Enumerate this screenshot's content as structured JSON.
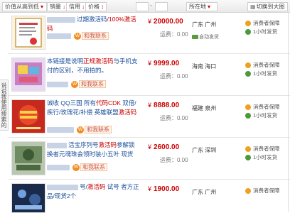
{
  "toolbar": {
    "credit_sort": "价值从高到低",
    "volume": "销量",
    "credit": "信用",
    "price": "价格",
    "price_from_placeholder": "",
    "price_to_placeholder": "",
    "all_regions": "所在地",
    "view_toggle": "切换到大图"
  },
  "sidebar_tab": "说说我使用搜索的感受",
  "listings": [
    {
      "title_pre": "",
      "title_mid": "过期激活码",
      "title_hl": "/100%激活码",
      "title_rest": "",
      "ww_text": "和我联系",
      "price": "20000.00",
      "currency": "¥",
      "sold": "运费：0.00",
      "location": "广东 广州",
      "ship_tag": "自动发货",
      "badge1": "消费者保障",
      "badge2": "1小时发货"
    },
    {
      "title_pre": "本链接是说明",
      "title_hl": "正规激活码",
      "title_mid": "与手机支付的区别，不用拍的。",
      "title_rest": "",
      "ww_text": "和我联系",
      "price": "9999.00",
      "currency": "¥",
      "sold": "运费：0.00",
      "location": "海南 海口",
      "ship_tag": "",
      "badge1": "消费者保障",
      "badge2": "1小时发货"
    },
    {
      "title_pre": "诚收 QQ三国 所有",
      "title_hl": "代码CDK",
      "title_mid": " 双倍/疾行/玫瑰花/补偿 英雄联盟",
      "title_rest": "激活码",
      "ww_text": "和我联系",
      "price": "8888.00",
      "currency": "¥",
      "sold": "运费：0.00",
      "location": "福建 泉州",
      "ship_tag": "",
      "badge1": "消费者保障",
      "badge2": "1小时发货"
    },
    {
      "title_pre": "",
      "title_mid": "活宝序列号",
      "title_hl": "激活码",
      "title_rest": "参解锁换者元魂珠会领时装小五叶 现货",
      "ww_text": "和我联系",
      "price": "2600.00",
      "currency": "¥",
      "sold": "运费：0.00",
      "location": "广东 深圳",
      "ship_tag": "",
      "badge1": "消费者保障",
      "badge2": "1小时发货"
    },
    {
      "title_pre": "",
      "title_mid": "号/",
      "title_hl": "激活码",
      "title_rest": " 试号 者方正品/现货2个",
      "ww_text": "",
      "price": "1900.00",
      "currency": "¥",
      "sold": "",
      "location": "广东 广州",
      "ship_tag": "",
      "badge1": "消费者保障",
      "badge2": ""
    }
  ],
  "colors": {
    "price": "#cc0000",
    "link": "#1a4f9c",
    "shield": "#f0a020",
    "clock": "#4a9a3a"
  }
}
